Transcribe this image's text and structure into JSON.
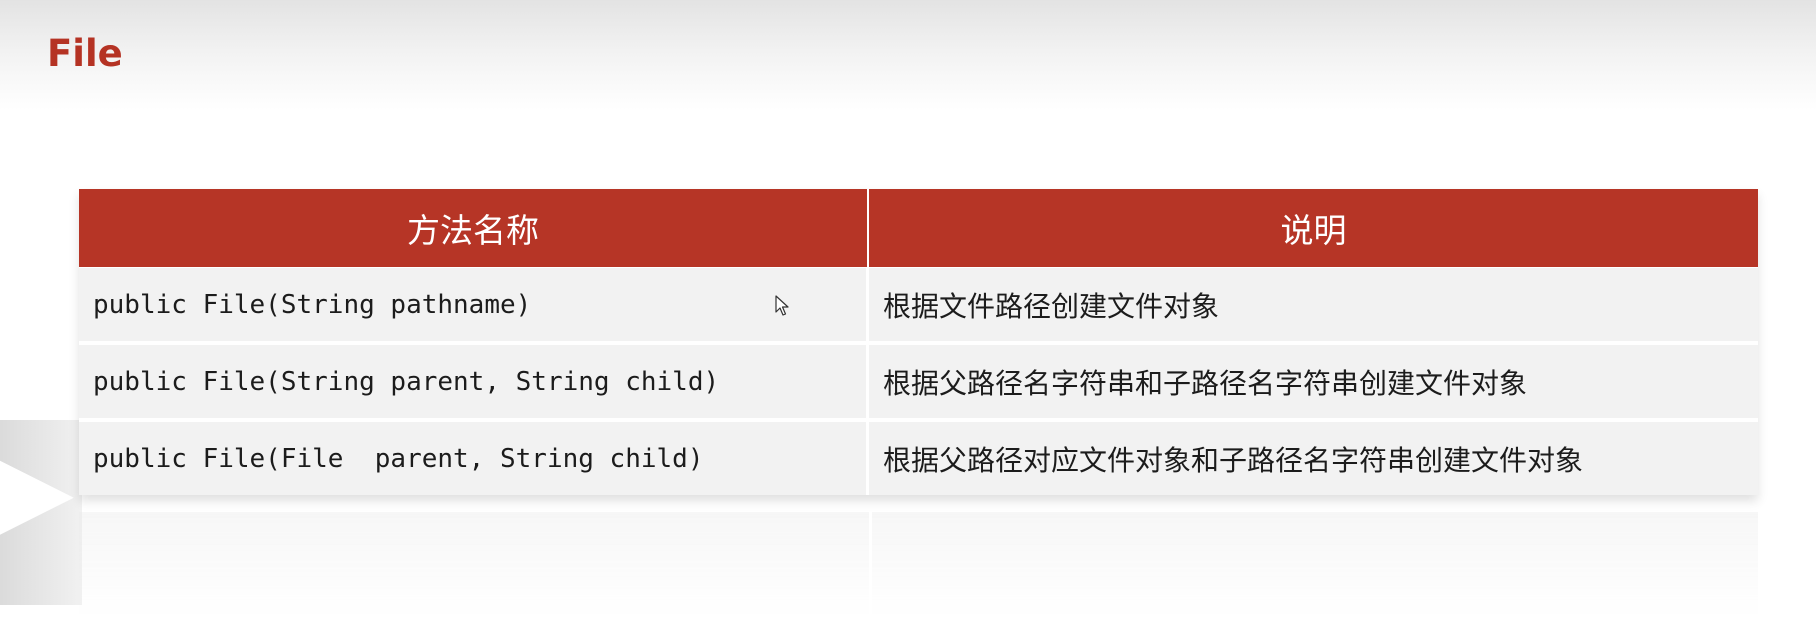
{
  "slide": {
    "title": "File"
  },
  "table": {
    "headers": [
      "方法名称",
      "说明"
    ],
    "rows": [
      {
        "method": "public File(String pathname)",
        "description": "根据文件路径创建文件对象"
      },
      {
        "method": "public File(String parent, String child)",
        "description": "根据父路径名字符串和子路径名字符串创建文件对象"
      },
      {
        "method": "public File(File  parent, String child)",
        "description": "根据父路径对应文件对象和子路径名字符串创建文件对象"
      }
    ]
  },
  "colors": {
    "accent": "#b63526",
    "title": "#b53324",
    "row_background": "#f2f2f2"
  },
  "icons": {
    "cursor": "mouse-pointer-icon"
  }
}
